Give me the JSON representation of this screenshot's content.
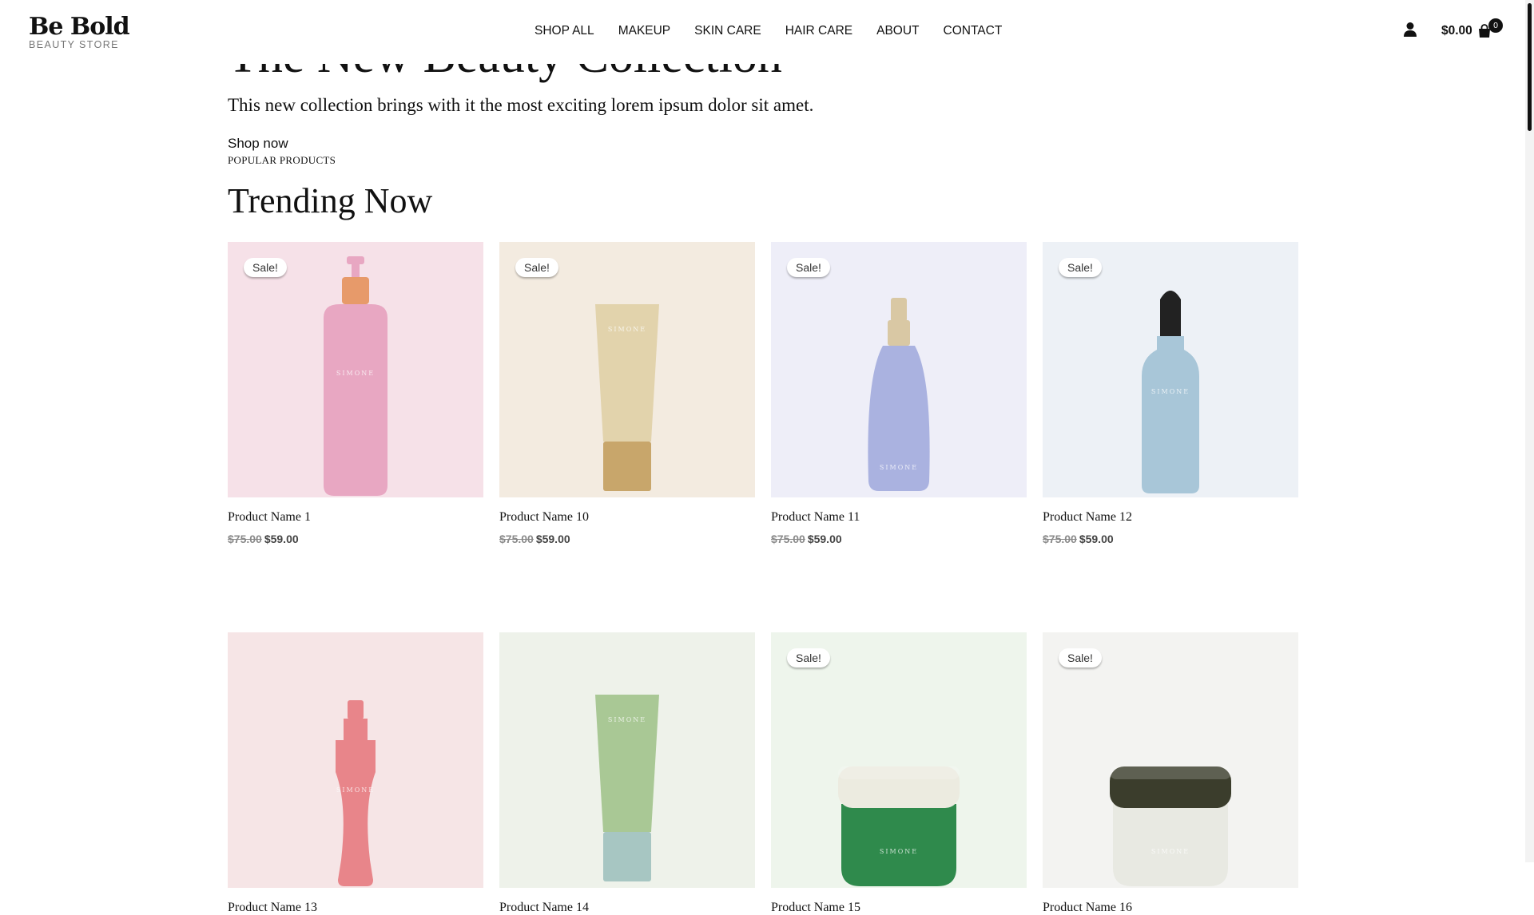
{
  "brand": {
    "name": "Be Bold",
    "tagline": "BEAUTY STORE"
  },
  "nav": [
    "SHOP ALL",
    "MAKEUP",
    "SKIN CARE",
    "HAIR CARE",
    "ABOUT",
    "CONTACT"
  ],
  "header": {
    "cart_total": "$0.00",
    "cart_count": "0",
    "account_icon": "user-icon",
    "cart_icon": "shopping-bag-icon"
  },
  "hero": {
    "title": "The New Beauty Collection",
    "subtitle": "This new collection brings with it the most exciting lorem ipsum dolor sit amet.",
    "cta": "Shop now"
  },
  "section": {
    "kicker": "POPULAR PRODUCTS",
    "title": "Trending Now"
  },
  "products": [
    {
      "name": "Product Name 1",
      "sale": "Sale!",
      "old_price": "$75.00",
      "price": "$59.00",
      "bg": "#f6e1e8",
      "color": "#e8a7c2",
      "accent": "#e79a6a",
      "kind": "pump",
      "label": "SIMONE"
    },
    {
      "name": "Product Name 10",
      "sale": "Sale!",
      "old_price": "$75.00",
      "price": "$59.00",
      "bg": "#f3ebe0",
      "color": "#e2d3ac",
      "accent": "#c8a66b",
      "kind": "tube",
      "label": "SIMONE"
    },
    {
      "name": "Product Name 11",
      "sale": "Sale!",
      "old_price": "$75.00",
      "price": "$59.00",
      "bg": "#eeeef8",
      "color": "#aab2e0",
      "accent": "#d9c8a4",
      "kind": "spray",
      "label": "SIMONE"
    },
    {
      "name": "Product Name 12",
      "sale": "Sale!",
      "old_price": "$75.00",
      "price": "$59.00",
      "bg": "#edf1f6",
      "color": "#a8c6d8",
      "accent": "#222222",
      "kind": "dropper",
      "label": "SIMONE"
    },
    {
      "name": "Product Name 13",
      "sale": "",
      "old_price": "",
      "price": "",
      "bg": "#f6e5e6",
      "color": "#e8858a",
      "accent": "#e8858a",
      "kind": "serum",
      "label": "SIMONE"
    },
    {
      "name": "Product Name 14",
      "sale": "",
      "old_price": "",
      "price": "",
      "bg": "#eef2ea",
      "color": "#a9c895",
      "accent": "#a7c6c2",
      "kind": "tube",
      "label": "SIMONE"
    },
    {
      "name": "Product Name 15",
      "sale": "Sale!",
      "old_price": "",
      "price": "",
      "bg": "#eef5ec",
      "color": "#2f8a4c",
      "accent": "#ecebe0",
      "kind": "jar",
      "label": "SIMONE"
    },
    {
      "name": "Product Name 16",
      "sale": "Sale!",
      "old_price": "",
      "price": "",
      "bg": "#f3f3f1",
      "color": "#e8e9e2",
      "accent": "#3b3d2c",
      "kind": "jar",
      "label": "SIMONE"
    }
  ]
}
